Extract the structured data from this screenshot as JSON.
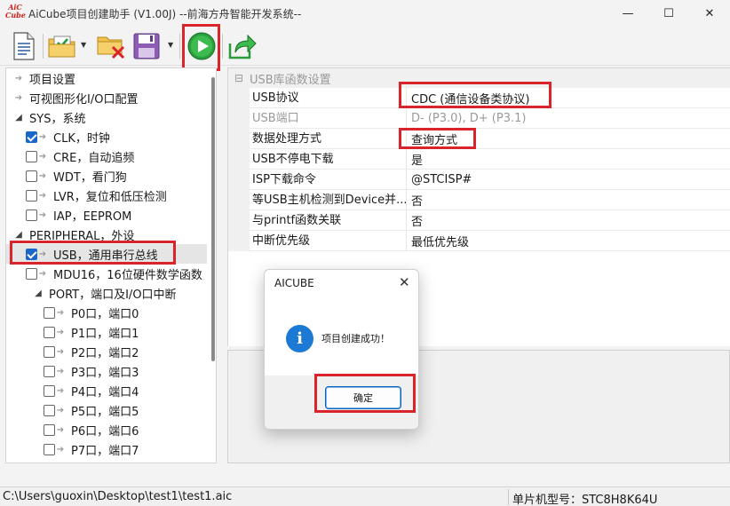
{
  "window": {
    "title": "AiCube项目创建助手 (V1.00J) --前海方舟智能开发系统--",
    "logo_line1": "AiC",
    "logo_line2": "Cube",
    "min_icon": "—",
    "max_icon": "☐",
    "close_icon": "✕"
  },
  "toolbar": {
    "icons": [
      "new-document-icon",
      "open-project-icon",
      "delete-project-icon",
      "save-icon",
      "run-icon",
      "export-icon"
    ],
    "dropdown_glyph": "▼"
  },
  "tree": {
    "items": [
      {
        "label": "项目设置",
        "kind": "arrow"
      },
      {
        "label": "可视图形化I/O口配置",
        "kind": "arrow"
      },
      {
        "label": "SYS，系统",
        "kind": "expand"
      },
      {
        "label": "CLK，时钟",
        "kind": "check",
        "checked": true
      },
      {
        "label": "CRE，自动追频",
        "kind": "check",
        "checked": false
      },
      {
        "label": "WDT，看门狗",
        "kind": "check",
        "checked": false
      },
      {
        "label": "LVR，复位和低压检测",
        "kind": "check",
        "checked": false
      },
      {
        "label": "IAP，EEPROM",
        "kind": "check",
        "checked": false
      },
      {
        "label": "PERIPHERAL，外设",
        "kind": "expand"
      },
      {
        "label": "USB，通用串行总线",
        "kind": "check",
        "checked": true,
        "selected": true
      },
      {
        "label": "MDU16，16位硬件数学函数",
        "kind": "check",
        "checked": false
      },
      {
        "label": "PORT，端口及I/O口中断",
        "kind": "expand"
      },
      {
        "label": "P0口，端口0",
        "kind": "check",
        "checked": false
      },
      {
        "label": "P1口，端口1",
        "kind": "check",
        "checked": false
      },
      {
        "label": "P2口，端口2",
        "kind": "check",
        "checked": false
      },
      {
        "label": "P3口，端口3",
        "kind": "check",
        "checked": false
      },
      {
        "label": "P4口，端口4",
        "kind": "check",
        "checked": false
      },
      {
        "label": "P5口，端口5",
        "kind": "check",
        "checked": false
      },
      {
        "label": "P6口，端口6",
        "kind": "check",
        "checked": false
      },
      {
        "label": "P7口，端口7",
        "kind": "check",
        "checked": false
      }
    ],
    "arrow_glyph": "➔",
    "expand_glyph": "◢"
  },
  "grid": {
    "section_toggle": "⊟",
    "section_title": "USB库函数设置",
    "rows": [
      {
        "name": "USB协议",
        "value": "CDC (通信设备类协议)",
        "dim": false
      },
      {
        "name": "USB端口",
        "value": "D- (P3.0), D+ (P3.1)",
        "dim": true
      },
      {
        "name": "数据处理方式",
        "value": "查询方式",
        "dim": false
      },
      {
        "name": "USB不停电下载",
        "value": "是",
        "dim": false
      },
      {
        "name": "ISP下载命令",
        "value": "@STCISP#",
        "dim": false
      },
      {
        "name": "等USB主机检测到Device并...",
        "value": "否",
        "dim": false
      },
      {
        "name": "与printf函数关联",
        "value": "否",
        "dim": false
      },
      {
        "name": "中断优先级",
        "value": "最低优先级",
        "dim": false
      }
    ]
  },
  "status": {
    "path": "C:\\Users\\guoxin\\Desktop\\test1\\test1.aic",
    "chip": "单片机型号：STC8H8K64U"
  },
  "dialog": {
    "title": "AICUBE",
    "close_icon": "✕",
    "icon_glyph": "i",
    "message": "项目创建成功！",
    "ok_label": "确定"
  },
  "colors": {
    "highlight": "#d9242b",
    "accent": "#1a66c9",
    "info": "#1c79d4"
  }
}
